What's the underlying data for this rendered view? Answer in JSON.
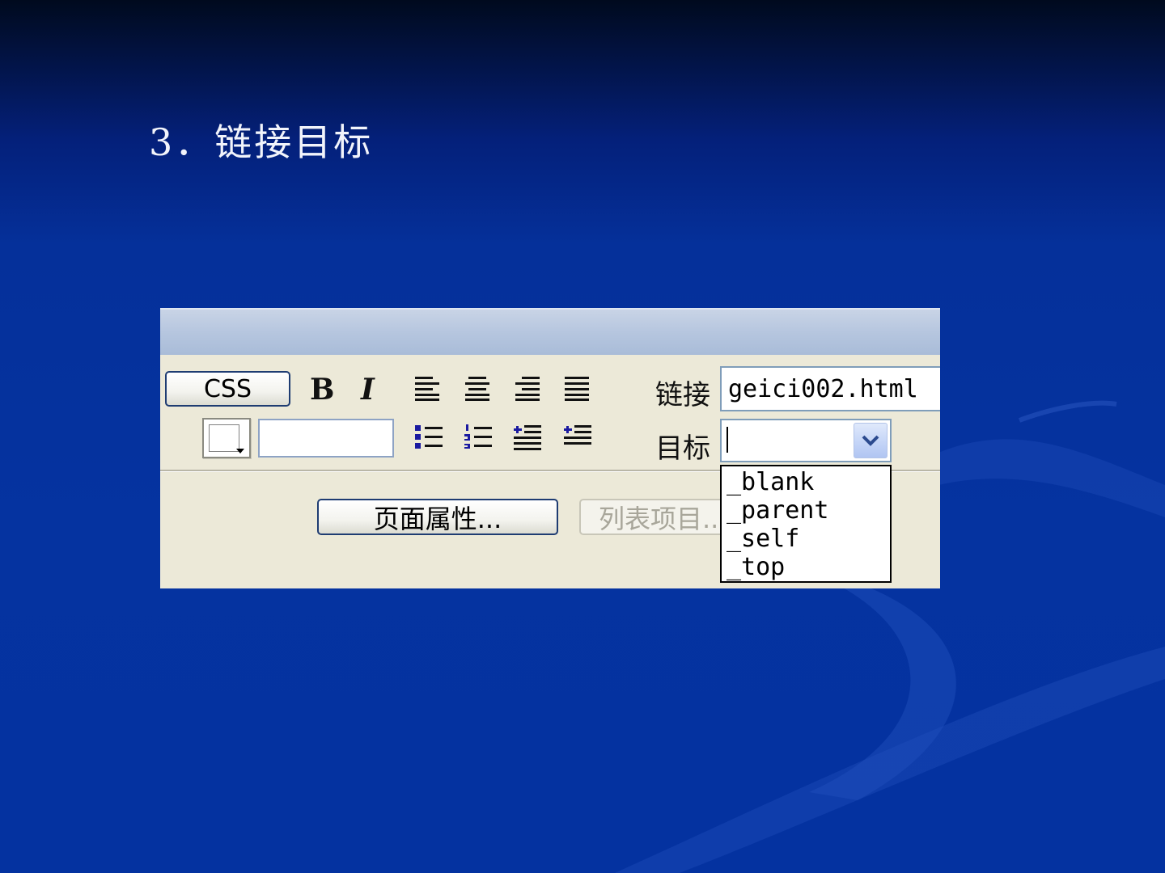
{
  "slide": {
    "title": "3．链接目标"
  },
  "inspector": {
    "css_button": "CSS",
    "bold": "B",
    "italic": "I",
    "link_label": "链接",
    "link_value": "geici002.html",
    "target_label": "目标",
    "target_value": "",
    "target_options": [
      "_blank",
      "_parent",
      "_self",
      "_top"
    ],
    "page_properties_button": "页面属性...",
    "list_item_button": "列表项目..."
  },
  "icons": [
    "align-left-icon",
    "align-center-icon",
    "align-right-icon",
    "justify-icon",
    "unordered-list-icon",
    "ordered-list-icon",
    "outdent-icon",
    "indent-icon",
    "color-picker-icon",
    "chevron-down-icon"
  ],
  "colors": {
    "background": "#0533a0",
    "panel": "#ece9d8",
    "panel_header": "#b6c6df",
    "button_border": "#1e3c72"
  }
}
